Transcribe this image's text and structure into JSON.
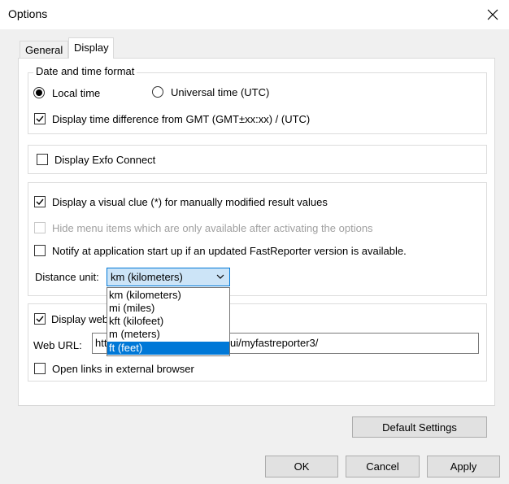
{
  "window": {
    "title": "Options"
  },
  "tabs": [
    {
      "label": "General",
      "active": false
    },
    {
      "label": "Display",
      "active": true
    }
  ],
  "datetime_group": {
    "legend": "Date and time format",
    "radio_local": {
      "label": "Local time",
      "checked": true
    },
    "radio_utc": {
      "label": "Universal time (UTC)",
      "checked": false
    },
    "gmt_check": {
      "label": "Display time difference from GMT (GMT±xx:xx) / (UTC)",
      "checked": true
    }
  },
  "exfo_check": {
    "label": "Display Exfo Connect",
    "checked": false
  },
  "options_group": {
    "visual_clue": {
      "label": "Display a visual clue (*) for manually modified result values",
      "checked": true
    },
    "hide_menu": {
      "label": "Hide menu items which are only available after activating the options",
      "checked": false,
      "disabled": true
    },
    "notify": {
      "label": "Notify at application start up if an updated FastReporter version is available.",
      "checked": false
    },
    "distance_label": "Distance unit:",
    "distance_value": "km (kilometers)",
    "distance_options": [
      "km (kilometers)",
      "mi (miles)",
      "kft (kilofeet)",
      "m (meters)",
      "ft (feet)"
    ],
    "highlighted_option": "ft (feet)"
  },
  "web_group": {
    "display_web_label": "Display web",
    "display_web_checked": true,
    "url_label": "Web URL:",
    "url_visible_left": "htt",
    "url_visible_right": "ui/myfastreporter3/",
    "external_browser": {
      "label": "Open links in external browser",
      "checked": false
    }
  },
  "buttons": {
    "default_settings": "Default Settings",
    "ok": "OK",
    "cancel": "Cancel",
    "apply": "Apply"
  }
}
